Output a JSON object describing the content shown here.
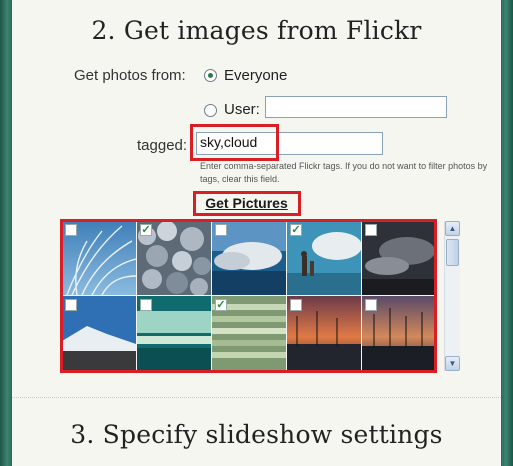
{
  "section2": {
    "title": "2. Get images from Flickr",
    "get_photos_from_label": "Get photos from:",
    "option_everyone": "Everyone",
    "option_user": "User:",
    "user_value": "",
    "tagged_label": "tagged:",
    "tagged_value": "sky,cloud",
    "hint": "Enter comma-separated Flickr tags. If you do not want to filter photos by tags, clear this field.",
    "get_pictures_button": "Get Pictures",
    "selected_option": "Everyone"
  },
  "thumbnails": [
    {
      "checked": false,
      "scene": "grass-sky"
    },
    {
      "checked": true,
      "scene": "cloud-texture"
    },
    {
      "checked": false,
      "scene": "sea-clouds"
    },
    {
      "checked": true,
      "scene": "beach-child"
    },
    {
      "checked": false,
      "scene": "dark-sky"
    },
    {
      "checked": false,
      "scene": "snowy-mountain"
    },
    {
      "checked": false,
      "scene": "teal-horizon"
    },
    {
      "checked": true,
      "scene": "stripes-light"
    },
    {
      "checked": false,
      "scene": "harbor-sunset"
    },
    {
      "checked": false,
      "scene": "marina-dusk"
    }
  ],
  "section3": {
    "title": "3. Specify slideshow settings"
  },
  "colors": {
    "highlight": "#d81f26",
    "frame": "#2c6b5b",
    "check": "#2a8a3a"
  }
}
